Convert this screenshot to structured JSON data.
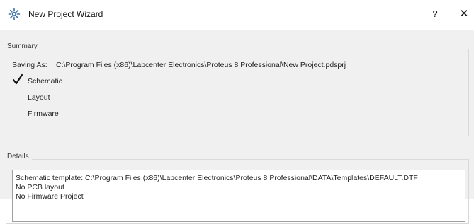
{
  "window": {
    "title": "New Project Wizard",
    "help_glyph": "?",
    "close_glyph": "✕"
  },
  "summary": {
    "title": "Summary",
    "saving_label": "Saving As:",
    "saving_path": "C:\\Program Files (x86)\\Labcenter Electronics\\Proteus 8 Professional\\New Project.pdsprj",
    "steps": [
      {
        "label": "Schematic",
        "checked": true
      },
      {
        "label": "Layout",
        "checked": false
      },
      {
        "label": "Firmware",
        "checked": false
      }
    ]
  },
  "details": {
    "title": "Details",
    "lines": [
      "Schematic template: C:\\Program Files (x86)\\Labcenter Electronics\\Proteus 8 Professional\\DATA\\Templates\\DEFAULT.DTF",
      "No PCB layout",
      "No Firmware Project"
    ]
  },
  "colors": {
    "client_bg": "#f0f0f0",
    "group_border": "#d9d9d9",
    "check_mark": "#111111"
  },
  "icons": {
    "app": "proteus-app-icon",
    "check": "check-mark-icon"
  }
}
